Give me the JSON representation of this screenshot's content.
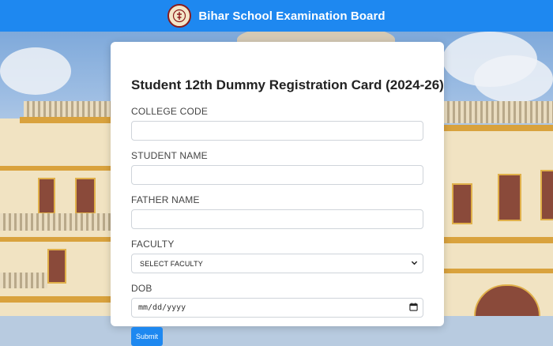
{
  "header": {
    "title": "Bihar School Examination Board",
    "logo_icon": "emblem-icon"
  },
  "form": {
    "title": "Student 12th Dummy Registration Card (2024-26)",
    "fields": {
      "college_code": {
        "label": "COLLEGE CODE",
        "value": ""
      },
      "student_name": {
        "label": "STUDENT NAME",
        "value": ""
      },
      "father_name": {
        "label": "FATHER NAME",
        "value": ""
      },
      "faculty": {
        "label": "FACULTY",
        "selected": "SELECT FACULTY"
      },
      "dob": {
        "label": "DOB",
        "placeholder": "mm/dd/yyyy",
        "icon": "calendar-icon"
      }
    },
    "submit_label": "Submit"
  },
  "colors": {
    "header_bg": "#1e88f0",
    "button_bg": "#1e88f0",
    "card_bg": "#ffffff"
  }
}
